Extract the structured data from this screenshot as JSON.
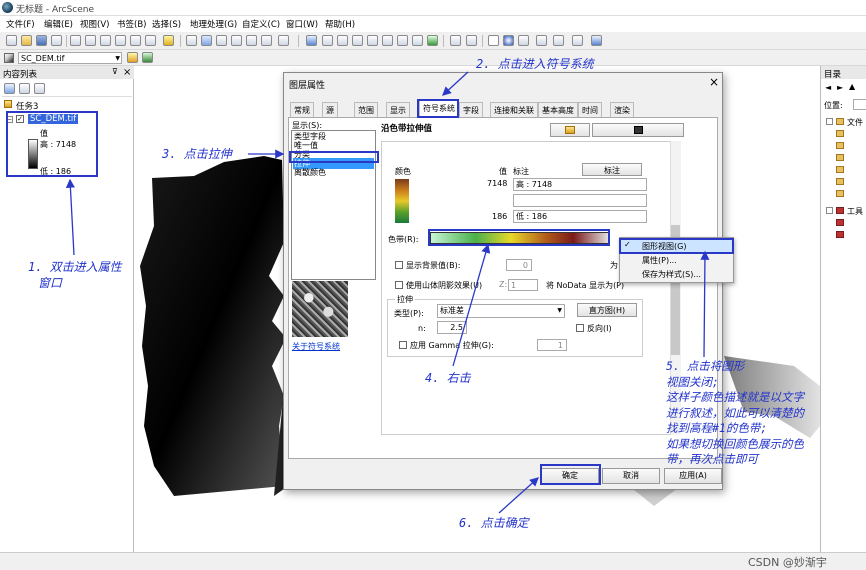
{
  "window": {
    "title": "无标题 - ArcScene"
  },
  "menu": [
    "文件(F)",
    "编辑(E)",
    "视图(V)",
    "书签(B)",
    "选择(S)",
    "地理处理(G)",
    "自定义(C)",
    "窗口(W)",
    "帮助(H)"
  ],
  "layer_combo": {
    "value": "SC_DEM.tif"
  },
  "toc": {
    "title": "内容列表",
    "close": "×",
    "group": "任务3",
    "layer": "SC_DEM.tif",
    "legend_label": "值",
    "high": "高 : 7148",
    "low": "低 : 186"
  },
  "catalog": {
    "title": "目录",
    "location_label": "位置:",
    "items": [
      "文件",
      "工具"
    ]
  },
  "dialog": {
    "title": "图层属性",
    "close": "×",
    "tabs": [
      "常规",
      "源",
      "范围",
      "显示",
      "符号系统",
      "字段",
      "连接和关联",
      "基本高度",
      "时间",
      "渲染"
    ],
    "show_label": "显示(S):",
    "renderers": [
      "唯一值",
      "分类",
      "拉伸",
      "离散颜色"
    ],
    "renderer_first": "类型字段",
    "about_link": "关于符号系统",
    "section_title": "沿色带拉伸值",
    "color_label": "颜色",
    "value_label": "值",
    "label_label": "标注",
    "label_button": "标注",
    "high_value": "7148",
    "high_label": "高 : 7148",
    "low_value": "186",
    "low_label": "低 : 186",
    "ramp_label": "色带(R):",
    "show_bg": "显示背景值(B):",
    "bg_value": "0",
    "bg_as": "为",
    "hillshade": "使用山体阴影效果(U)",
    "z_label": "Z:",
    "z_value": "1",
    "nodata": "将 NoData 显示为(P)",
    "stretch_title": "拉伸",
    "type_label": "类型(P):",
    "type_value": "标准差",
    "histogram_btn": "直方图(H)",
    "n_label": "n:",
    "n_value": "2.5",
    "invert": "反向(I)",
    "gamma": "应用 Gamma 拉伸(G):",
    "gamma_value": "1",
    "ok": "确定",
    "cancel": "取消",
    "apply": "应用(A)"
  },
  "context_menu": {
    "items": [
      "图形视图(G)",
      "属性(P)...",
      "保存为样式(S)..."
    ]
  },
  "annotations": {
    "a1": [
      "1. 双击进入属性",
      "窗口"
    ],
    "a2": "2. 点击进入符号系统",
    "a3": "3. 点击拉伸",
    "a4": "4. 右击",
    "a5": [
      "5. 点击将图形",
      "视图关闭;",
      "这样子颜色描述就是以文字",
      "进行叙述，如此可以清楚的",
      "找到高程#1的色带;",
      "如果想切换回颜色展示的色",
      "带，再次点击即可"
    ],
    "a6": "6. 点击确定"
  },
  "watermark": "CSDN @妙渐宇",
  "colors": {
    "annotation": "#2233cc",
    "selection": "#3399ff"
  }
}
